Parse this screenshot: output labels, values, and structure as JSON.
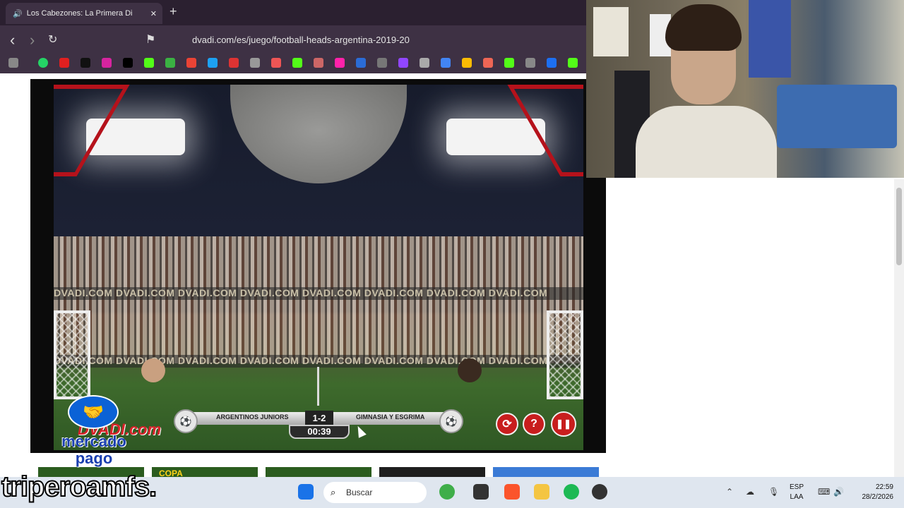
{
  "browser": {
    "tab_title": "Los Cabezones: La Primera Di",
    "tab_close": "✕",
    "new_tab": "+",
    "url": "dvadi.com/es/juego/football-heads-argentina-2019-20",
    "back": "‹",
    "forward": "›",
    "reload": "↻"
  },
  "game": {
    "ad_text": "DVADI.COM DVADI.COM DVADI.COM DVADI.COM DVADI.COM DVADI.COM DVADI.COM DVADI.COM",
    "team_left": "ARGENTINOS JUNIORS",
    "team_right": "GIMNASIA Y ESGRIMA",
    "score": "1-2",
    "timer": "00:39",
    "logo": "DVADI.com",
    "controls": {
      "restart": "⟳",
      "help": "?",
      "pause": "❚❚"
    }
  },
  "overlay": {
    "mp_line1": "mercado",
    "mp_line2": "pago",
    "watermark": "triperoamfs."
  },
  "thumbnails": [
    "",
    "COPA",
    "",
    "",
    ""
  ],
  "taskbar": {
    "search_placeholder": "Buscar",
    "lang_line1": "ESP",
    "lang_line2": "LAA",
    "time": "22:59",
    "date": "28/2/2026"
  }
}
